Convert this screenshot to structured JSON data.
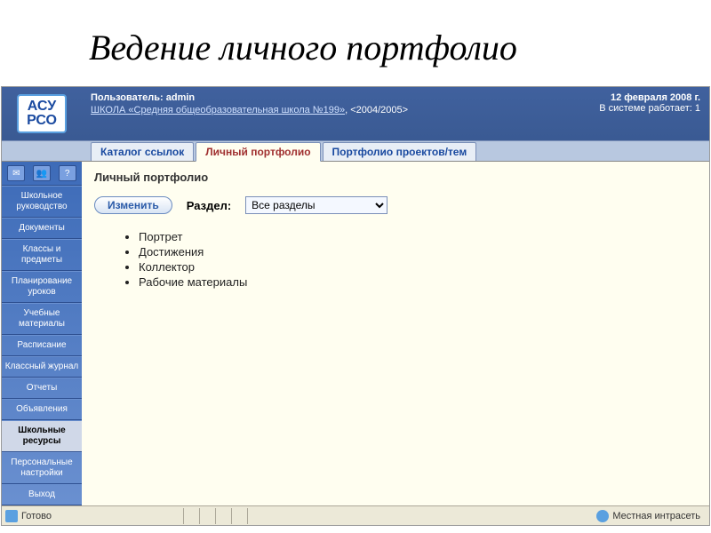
{
  "slide_title": "Ведение личного портфолио",
  "logo": {
    "top": "АСУ",
    "bottom": "РСО"
  },
  "header": {
    "user_prefix": "Пользователь: ",
    "user_name": "admin",
    "school_link": "ШКОЛА «Средняя общеобразовательная школа №199»",
    "year": ", <2004/2005>",
    "date": "12 февраля 2008 г.",
    "online_label": "В системе работает: ",
    "online_count": "1"
  },
  "tabs": [
    {
      "label": "Каталог ссылок",
      "active": false
    },
    {
      "label": "Личный портфолио",
      "active": true
    },
    {
      "label": "Портфолио проектов/тем",
      "active": false
    }
  ],
  "sidebar_icons": [
    "mail",
    "users",
    "help"
  ],
  "sidebar": [
    {
      "label": "Школьное руководство"
    },
    {
      "label": "Документы"
    },
    {
      "label": "Классы и предметы"
    },
    {
      "label": "Планирование уроков"
    },
    {
      "label": "Учебные материалы"
    },
    {
      "label": "Расписание"
    },
    {
      "label": "Классный журнал"
    },
    {
      "label": "Отчеты"
    },
    {
      "label": "Объявления"
    },
    {
      "label": "Школьные ресурсы",
      "selected": true
    },
    {
      "label": "Персональные настройки"
    },
    {
      "label": "Выход"
    }
  ],
  "content": {
    "heading": "Личный портфолио",
    "edit_button": "Изменить",
    "section_label": "Раздел:",
    "section_value": "Все разделы",
    "items": [
      "Портрет",
      "Достижения",
      "Коллектор",
      "Рабочие материалы"
    ]
  },
  "statusbar": {
    "left": "Готово",
    "zone": "Местная интрасеть"
  }
}
